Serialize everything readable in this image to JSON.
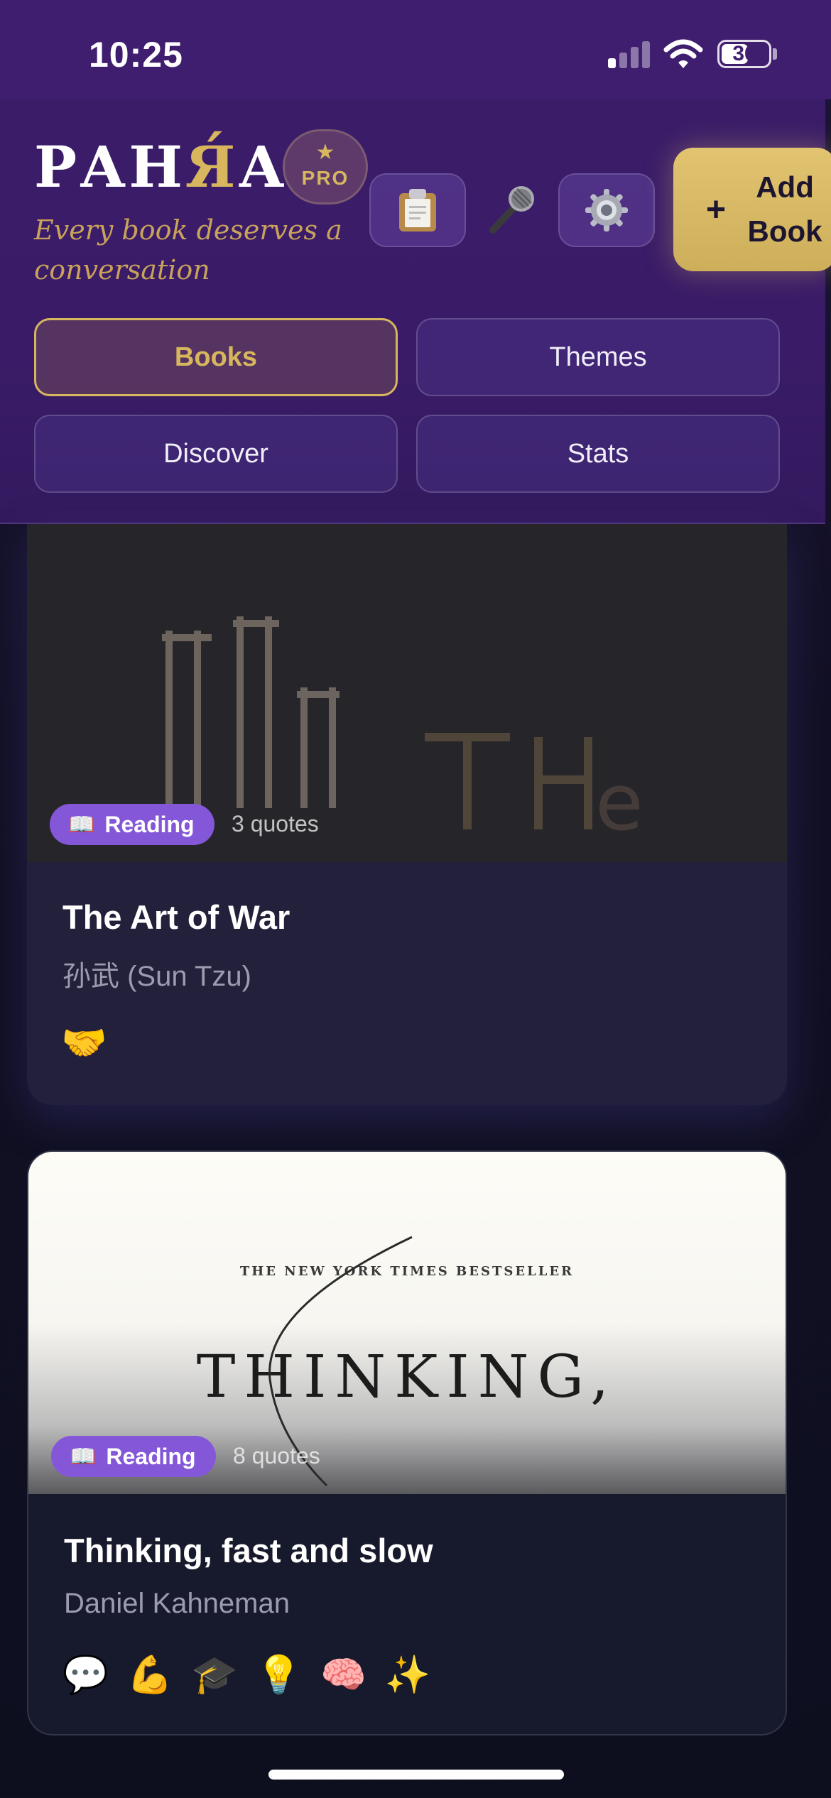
{
  "status_bar": {
    "time": "10:25",
    "battery": "36"
  },
  "header": {
    "logo_prefix": "РАН",
    "logo_ya": "Я́",
    "logo_suffix": "А",
    "pro_label": "PRO",
    "tagline": "Every book deserves a conversation",
    "add_book_plus": "+",
    "add_book_label": "Add Book",
    "icons": [
      "clipboard-icon",
      "microphone-icon",
      "gear-icon"
    ]
  },
  "tabs": [
    {
      "label": "Books",
      "active": true
    },
    {
      "label": "Themes",
      "active": false
    },
    {
      "label": "Discover",
      "active": false
    },
    {
      "label": "Stats",
      "active": false
    }
  ],
  "books": [
    {
      "status": "Reading",
      "status_icon": "📖",
      "quotes": "3 quotes",
      "title": "The Art of War",
      "author": "孙武 (Sun Tzu)",
      "theme_emojis": [
        "🤝"
      ]
    },
    {
      "status": "Reading",
      "status_icon": "📖",
      "quotes": "8 quotes",
      "title": "Thinking, fast and slow",
      "author": "Daniel Kahneman",
      "theme_emojis": [
        "💬",
        "💪",
        "🎓",
        "💡",
        "🧠",
        "✨"
      ],
      "cover_top_text": "THE NEW YORK TIMES BESTSELLER",
      "cover_title": "THINKING,"
    }
  ]
}
